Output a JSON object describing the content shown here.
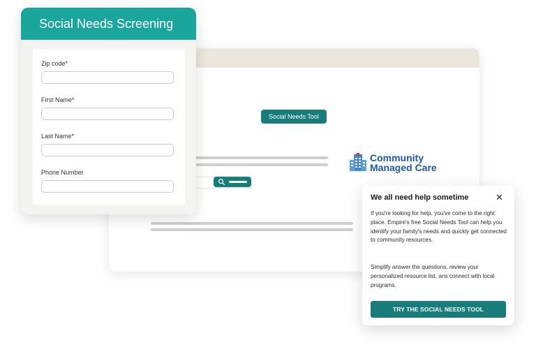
{
  "form": {
    "title": "Social Needs Screening",
    "fields": [
      {
        "label": "Zip code*",
        "value": ""
      },
      {
        "label": "First Name*",
        "value": ""
      },
      {
        "label": "Last Name*",
        "value": ""
      },
      {
        "label": "Phone Number",
        "value": ""
      }
    ]
  },
  "background": {
    "tool_button_label": "Social Needs Tool",
    "logo": {
      "line1": "Community",
      "line2": "Managed Care"
    }
  },
  "popup": {
    "title": "We all need help sometime",
    "close_icon": "close-icon",
    "paragraph1": "If you're looking for help, you've come to the right place. Empire's free Social Needs Tool can help you identify your family's needs and quickly get connected to community resources.",
    "paragraph2": "Simplify answer the questions, review your personalized resource list, ans connect with local programs.",
    "cta_label": "TRY THE SOCIAL NEEDS TOOL"
  },
  "colors": {
    "teal": "#1aa59d",
    "dark_teal": "#167d7a",
    "brand_blue": "#1d59a8"
  }
}
